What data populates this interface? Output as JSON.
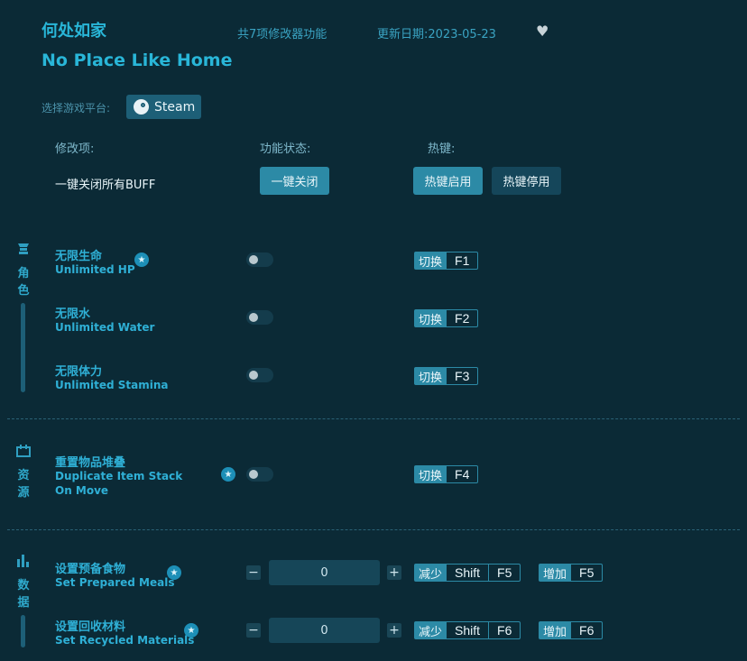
{
  "header": {
    "title_cn": "何处如家",
    "title_en": "No Place Like Home",
    "feature_count": "共7项修改器功能",
    "update_date": "更新日期:2023-05-23",
    "favorite_icon": "heart-icon"
  },
  "platform": {
    "label": "选择游戏平台:",
    "button_label": "Steam",
    "icon": "steam-icon"
  },
  "columns": {
    "mod": "修改项:",
    "status": "功能状态:",
    "hotkey": "热键:"
  },
  "global": {
    "label": "一键关闭所有BUFF",
    "close_all": "一键关闭",
    "hotkey_enable": "热键启用",
    "hotkey_disable": "热键停用"
  },
  "categories": [
    {
      "label_1": "角",
      "label_2": "色",
      "icon": "character-icon"
    },
    {
      "label_1": "资",
      "label_2": "源",
      "icon": "resources-icon"
    },
    {
      "label_1": "数",
      "label_2": "据",
      "icon": "data-icon"
    }
  ],
  "features": [
    {
      "cn": "无限生命",
      "en": "Unlimited HP",
      "starred": true,
      "toggle": "切换",
      "key": "F1"
    },
    {
      "cn": "无限水",
      "en": "Unlimited Water",
      "starred": false,
      "toggle": "切换",
      "key": "F2"
    },
    {
      "cn": "无限体力",
      "en": "Unlimited Stamina",
      "starred": false,
      "toggle": "切换",
      "key": "F3"
    },
    {
      "cn": "重置物品堆叠",
      "en": "Duplicate Item Stack On Move",
      "starred": true,
      "toggle": "切换",
      "key": "F4"
    }
  ],
  "numeric": [
    {
      "cn": "设置预备食物",
      "en": "Set Prepared Meals",
      "value": "0",
      "minus": "−",
      "plus": "+",
      "dec_label": "减少",
      "dec_mod": "Shift",
      "dec_key": "F5",
      "inc_label": "增加",
      "inc_key": "F5"
    },
    {
      "cn": "设置回收材料",
      "en": "Set Recycled Materials",
      "value": "0",
      "minus": "−",
      "plus": "+",
      "dec_label": "减少",
      "dec_mod": "Shift",
      "dec_key": "F6",
      "inc_label": "增加",
      "inc_key": "F6"
    }
  ],
  "colors": {
    "background": "#0b2a36",
    "accent": "#29b6d8",
    "button": "#2c8aa6"
  }
}
